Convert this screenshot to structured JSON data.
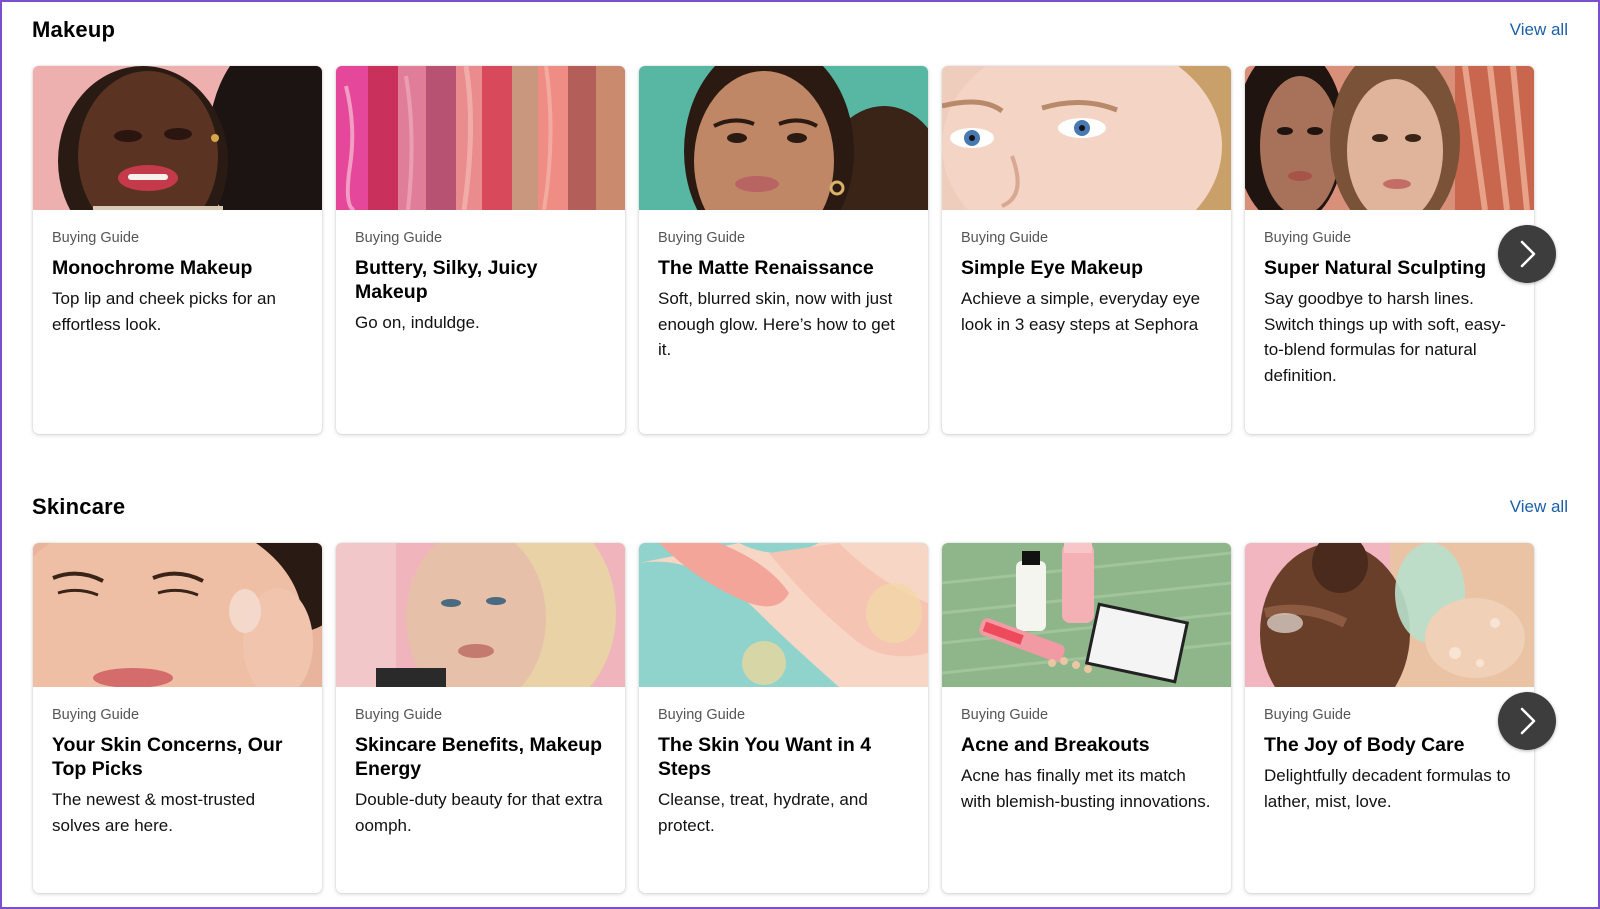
{
  "sections": [
    {
      "title": "Makeup",
      "view_all": "View all",
      "cards": [
        {
          "kicker": "Buying Guide",
          "title": "Monochrome Makeup",
          "desc": "Top lip and cheek picks for an effortless look."
        },
        {
          "kicker": "Buying Guide",
          "title": "Buttery, Silky, Juicy Makeup",
          "desc": "Go on, induldge."
        },
        {
          "kicker": "Buying Guide",
          "title": "The Matte Renaissance",
          "desc": "Soft, blurred skin, now with just enough glow. Here’s how to get it."
        },
        {
          "kicker": "Buying Guide",
          "title": "Simple Eye Makeup",
          "desc": "Achieve a simple, everyday eye look in 3 easy steps at Sephora"
        },
        {
          "kicker": "Buying Guide",
          "title": "Super Natural Sculpting",
          "desc": "Say goodbye to harsh lines. Switch things up with soft, easy-to-blend formulas for natural definition."
        }
      ]
    },
    {
      "title": "Skincare",
      "view_all": "View all",
      "cards": [
        {
          "kicker": "Buying Guide",
          "title": "Your Skin Concerns, Our Top Picks",
          "desc": "The newest & most-trusted solves are here."
        },
        {
          "kicker": "Buying Guide",
          "title": "Skincare Benefits, Makeup Energy",
          "desc": "Double-duty beauty for that extra oomph."
        },
        {
          "kicker": "Buying Guide",
          "title": "The Skin You Want in 4 Steps",
          "desc": "Cleanse, treat, hydrate, and protect."
        },
        {
          "kicker": "Buying Guide",
          "title": "Acne and Breakouts",
          "desc": "Acne has finally met its match with blemish-busting innovations."
        },
        {
          "kicker": "Buying Guide",
          "title": "The Joy of Body Care",
          "desc": "Delightfully decadent formulas to lather, mist, love."
        }
      ]
    }
  ],
  "colors": {
    "link": "#1b5fa8",
    "arrow_button": "#3d3d3d",
    "frame": "#7b4fd0"
  },
  "icons": {
    "next": "chevron-right-icon"
  }
}
